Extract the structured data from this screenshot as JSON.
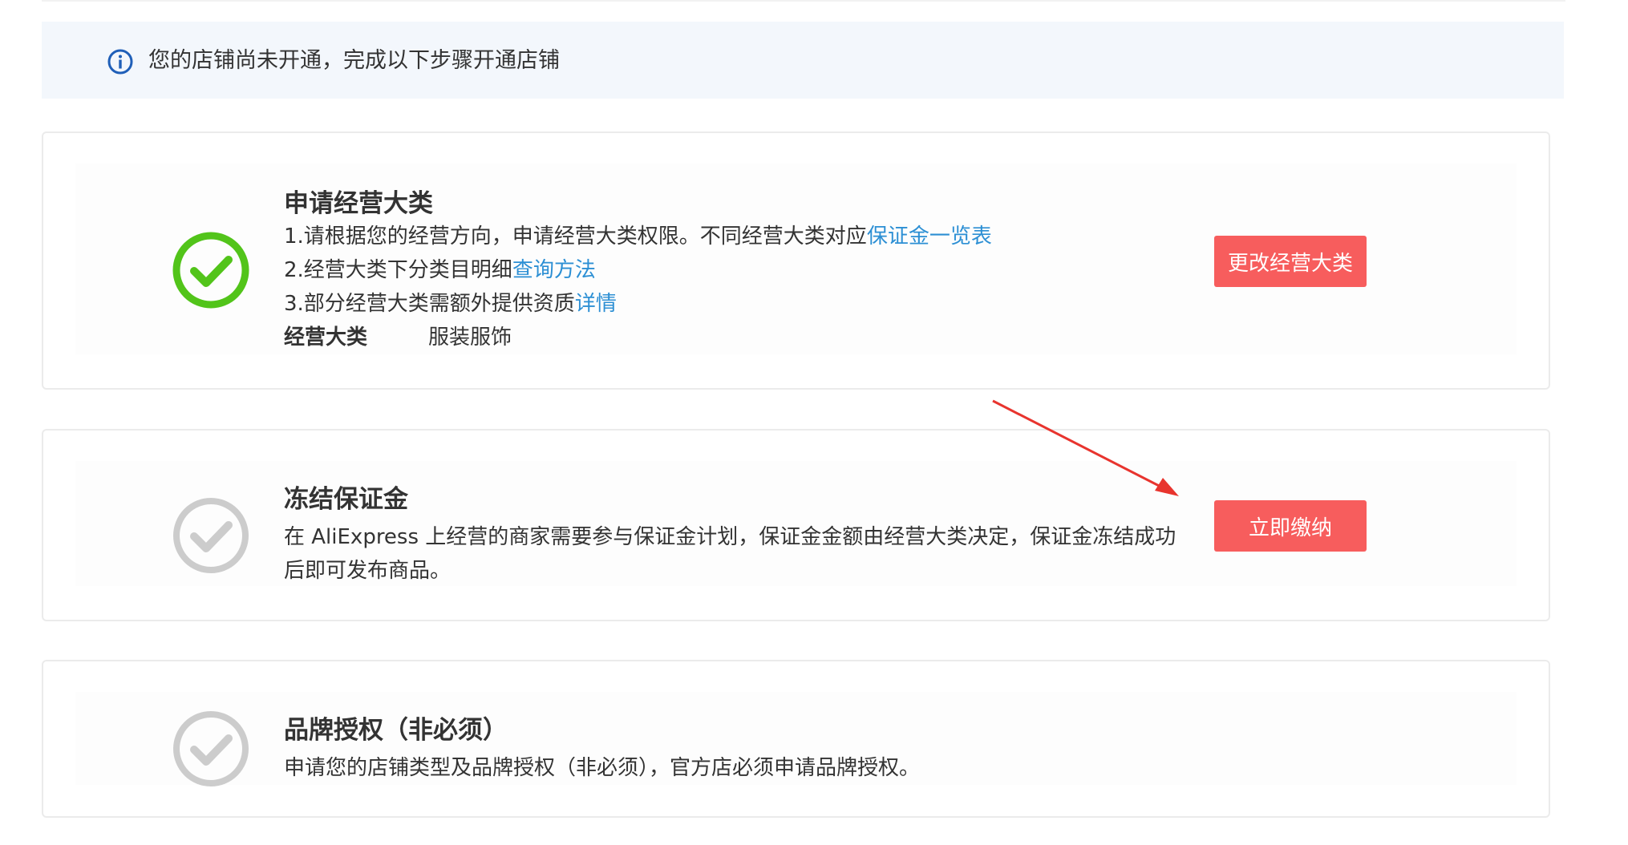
{
  "notice": {
    "text": "您的店铺尚未开通，完成以下步骤开通店铺"
  },
  "steps": [
    {
      "title": "申请经营大类",
      "status": "done",
      "lines": [
        {
          "text": "1.请根据您的经营方向，申请经营大类权限。不同经营大类对应",
          "link": "保证金一览表"
        },
        {
          "text": "2.经营大类下分类目明细",
          "link": "查询方法"
        },
        {
          "text": "3.部分经营大类需额外提供资质",
          "link": "详情"
        }
      ],
      "kv": {
        "key": "经营大类",
        "value": "服装服饰"
      },
      "button": "更改经营大类"
    },
    {
      "title": "冻结保证金",
      "status": "pending",
      "desc_line1": "在 AliExpress 上经营的商家需要参与保证金计划，保证金金额由经营大类决定，保证金冻结成功",
      "desc_line2": "后即可发布商品。",
      "button": "立即缴纳"
    },
    {
      "title": "品牌授权（非必须）",
      "status": "pending",
      "desc_line1": "申请您的店铺类型及品牌授权（非必须），官方店必须申请品牌授权。"
    }
  ],
  "colors": {
    "accent_button": "#f75d5d",
    "link": "#2c8fd4",
    "done_check": "#52c41a",
    "pending_check": "#cccccc",
    "annotation_arrow": "#e8342e"
  }
}
